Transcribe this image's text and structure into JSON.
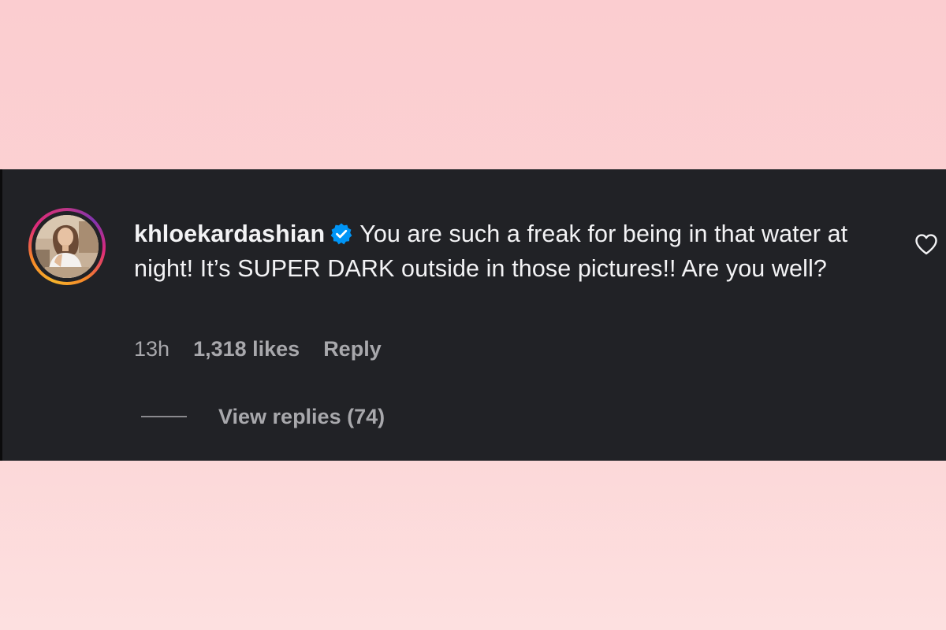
{
  "comment": {
    "username": "khloekardashian",
    "verified": true,
    "text": "You are such a freak for being in that water at night! It’s SUPER DARK outside in those pictures!! Are you well?",
    "time": "13h",
    "likes": "1,318 likes",
    "reply_label": "Reply",
    "view_replies_label": "View replies (74)",
    "liked": false
  },
  "icons": {
    "verified": "verified-badge-icon",
    "like": "heart-outline-icon"
  },
  "colors": {
    "background_top": "#fbcdd0",
    "panel": "#212226",
    "text": "#f3f3f5",
    "muted_text": "#a8a8ac",
    "verified_badge": "#0095f6",
    "story_ring_start": "#f7b32b",
    "story_ring_end": "#c13584"
  }
}
